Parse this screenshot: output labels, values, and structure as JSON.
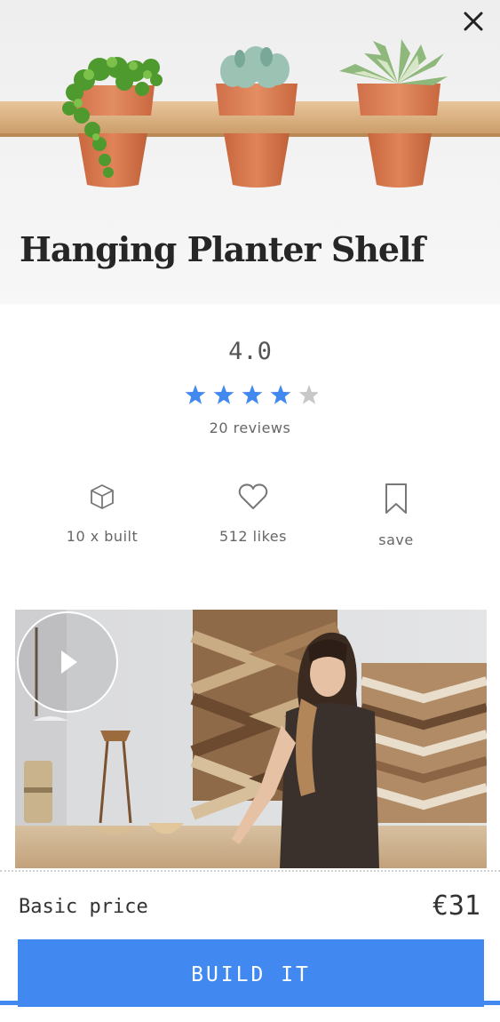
{
  "hero": {
    "title": "Hanging Planter Shelf",
    "image_subject": "three succulent pots on wooden shelf"
  },
  "close_icon": "close-icon",
  "rating": {
    "value": "4.0",
    "stars": 4,
    "max_stars": 5,
    "reviews": "20 reviews",
    "star_color": "#4189f0",
    "star_empty_color": "#c8c8c8"
  },
  "actions": {
    "built": {
      "icon": "cube-icon",
      "label": "10 x built"
    },
    "likes": {
      "icon": "heart-icon",
      "label": "512 likes"
    },
    "save": {
      "icon": "bookmark-icon",
      "label": "save"
    }
  },
  "video": {
    "play_icon": "play-icon"
  },
  "price": {
    "label": "Basic price",
    "value": "€31"
  },
  "cta": {
    "label": "BUILD IT",
    "color": "#4189f0"
  }
}
